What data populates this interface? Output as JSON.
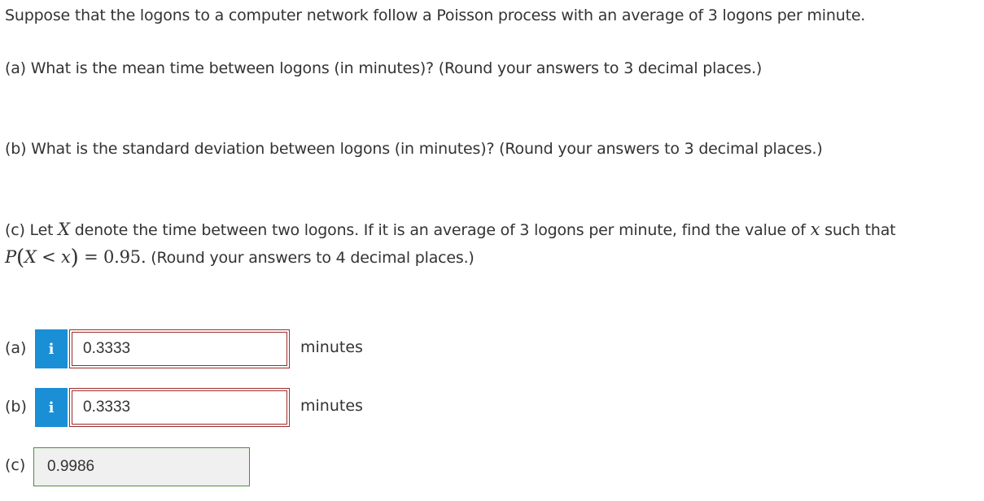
{
  "intro": "Suppose that the logons to a computer network follow a Poisson process with an average of 3 logons per minute.",
  "question_a": "(a) What is the mean time between logons (in minutes)? (Round your answers to 3 decimal places.)",
  "question_b": "(b) What is the standard deviation between logons (in minutes)? (Round your answers to 3 decimal places.)",
  "question_c": {
    "prefix": "(c) Let ",
    "var_X": "X",
    "mid": " denote the time between two logons. If it is an average of 3 logons per minute, find the value of ",
    "var_x": "x",
    "suffix": " such that",
    "eq_P": "P",
    "eq_open": "(",
    "eq_X": "X",
    "eq_lt": " < ",
    "eq_x": "x",
    "eq_close": ")",
    "eq_equals": " = ",
    "eq_value": "0.95",
    "eq_period": ".",
    "tail": " (Round your answers to 4 decimal places.)"
  },
  "answers": {
    "a": {
      "label": "(a)",
      "info_icon": "i",
      "value": "0.3333",
      "unit": "minutes"
    },
    "b": {
      "label": "(b)",
      "info_icon": "i",
      "value": "0.3333",
      "unit": "minutes"
    },
    "c": {
      "label": "(c)",
      "value": "0.9986"
    }
  },
  "colors": {
    "info_button": "#1a8fd6",
    "incorrect_border": "#9c2b2b",
    "correct_border": "#4a8f3d"
  }
}
